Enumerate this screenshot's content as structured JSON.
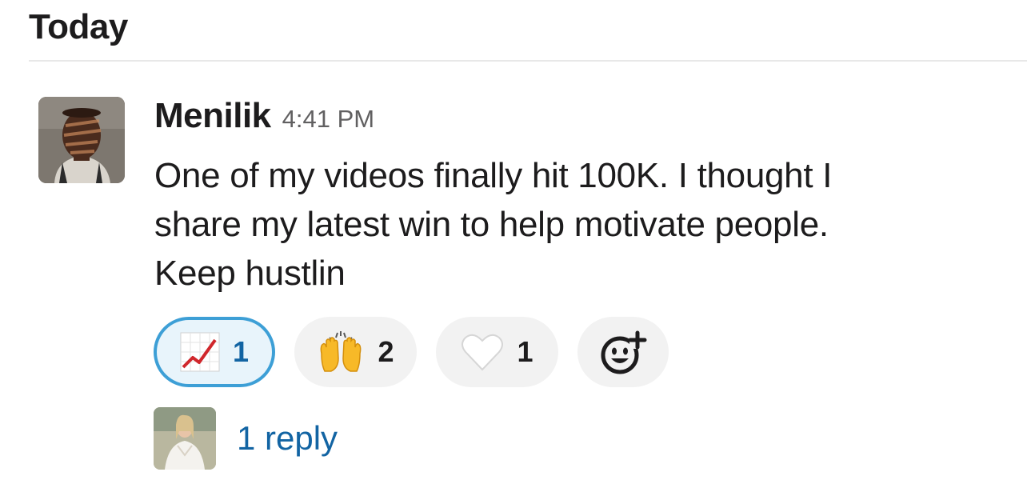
{
  "day_divider": {
    "label": "Today"
  },
  "message": {
    "author": "Menilik",
    "timestamp": "4:41 PM",
    "lines": [
      "One of my videos finally hit 100K. I thought I",
      "share my latest win to help motivate people.",
      "Keep hustlin"
    ],
    "avatar_icon": "user-avatar-photo"
  },
  "reactions": [
    {
      "emoji_name": "chart-increasing-emoji",
      "count": "1",
      "own": true
    },
    {
      "emoji_name": "raising-hands-emoji",
      "count": "2",
      "own": false
    },
    {
      "emoji_name": "white-heart-emoji",
      "count": "1",
      "own": false
    }
  ],
  "add_reaction": {
    "icon": "add-emoji-icon"
  },
  "thread": {
    "reply_label": "1 reply",
    "replier_avatar_icon": "replier-avatar-photo"
  },
  "colors": {
    "link": "#1264a3",
    "own_reaction_border": "#3d9fd6",
    "own_reaction_bg": "#e8f4fb",
    "reaction_bg": "#f2f2f2",
    "timestamp": "#616061"
  }
}
